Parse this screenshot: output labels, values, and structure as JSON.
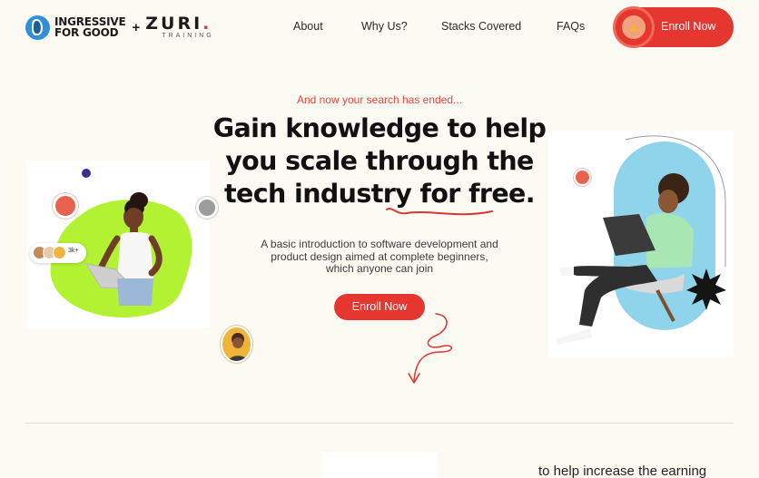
{
  "brand": {
    "ingressive_line1": "INGRESSIVE",
    "ingressive_line2": "FOR GOOD",
    "plus": "+",
    "zuri": "ZURI",
    "zuri_dot": ".",
    "zuri_sub": "TRAINING"
  },
  "nav": {
    "links": [
      "About",
      "Why Us?",
      "Stacks Covered",
      "FAQs"
    ],
    "enroll_label": "Enroll Now",
    "enroll_icon": "thumbs-up-icon"
  },
  "hero": {
    "tagline": "And now your search has ended...",
    "headline": "Gain knowledge to help you scale through the tech industry for free.",
    "description": "A basic introduction to software development and product design aimed at complete beginners, which anyone can join",
    "cta_label": "Enroll Now",
    "avatar_count": "3k+"
  },
  "bottom": {
    "partial_text": "to help increase the earning"
  },
  "colors": {
    "accent": "#e5362f",
    "tagline": "#e0493a",
    "background": "#fdfaf3",
    "blob_green": "#b2f233",
    "panel_blue": "#8fd4ea"
  }
}
